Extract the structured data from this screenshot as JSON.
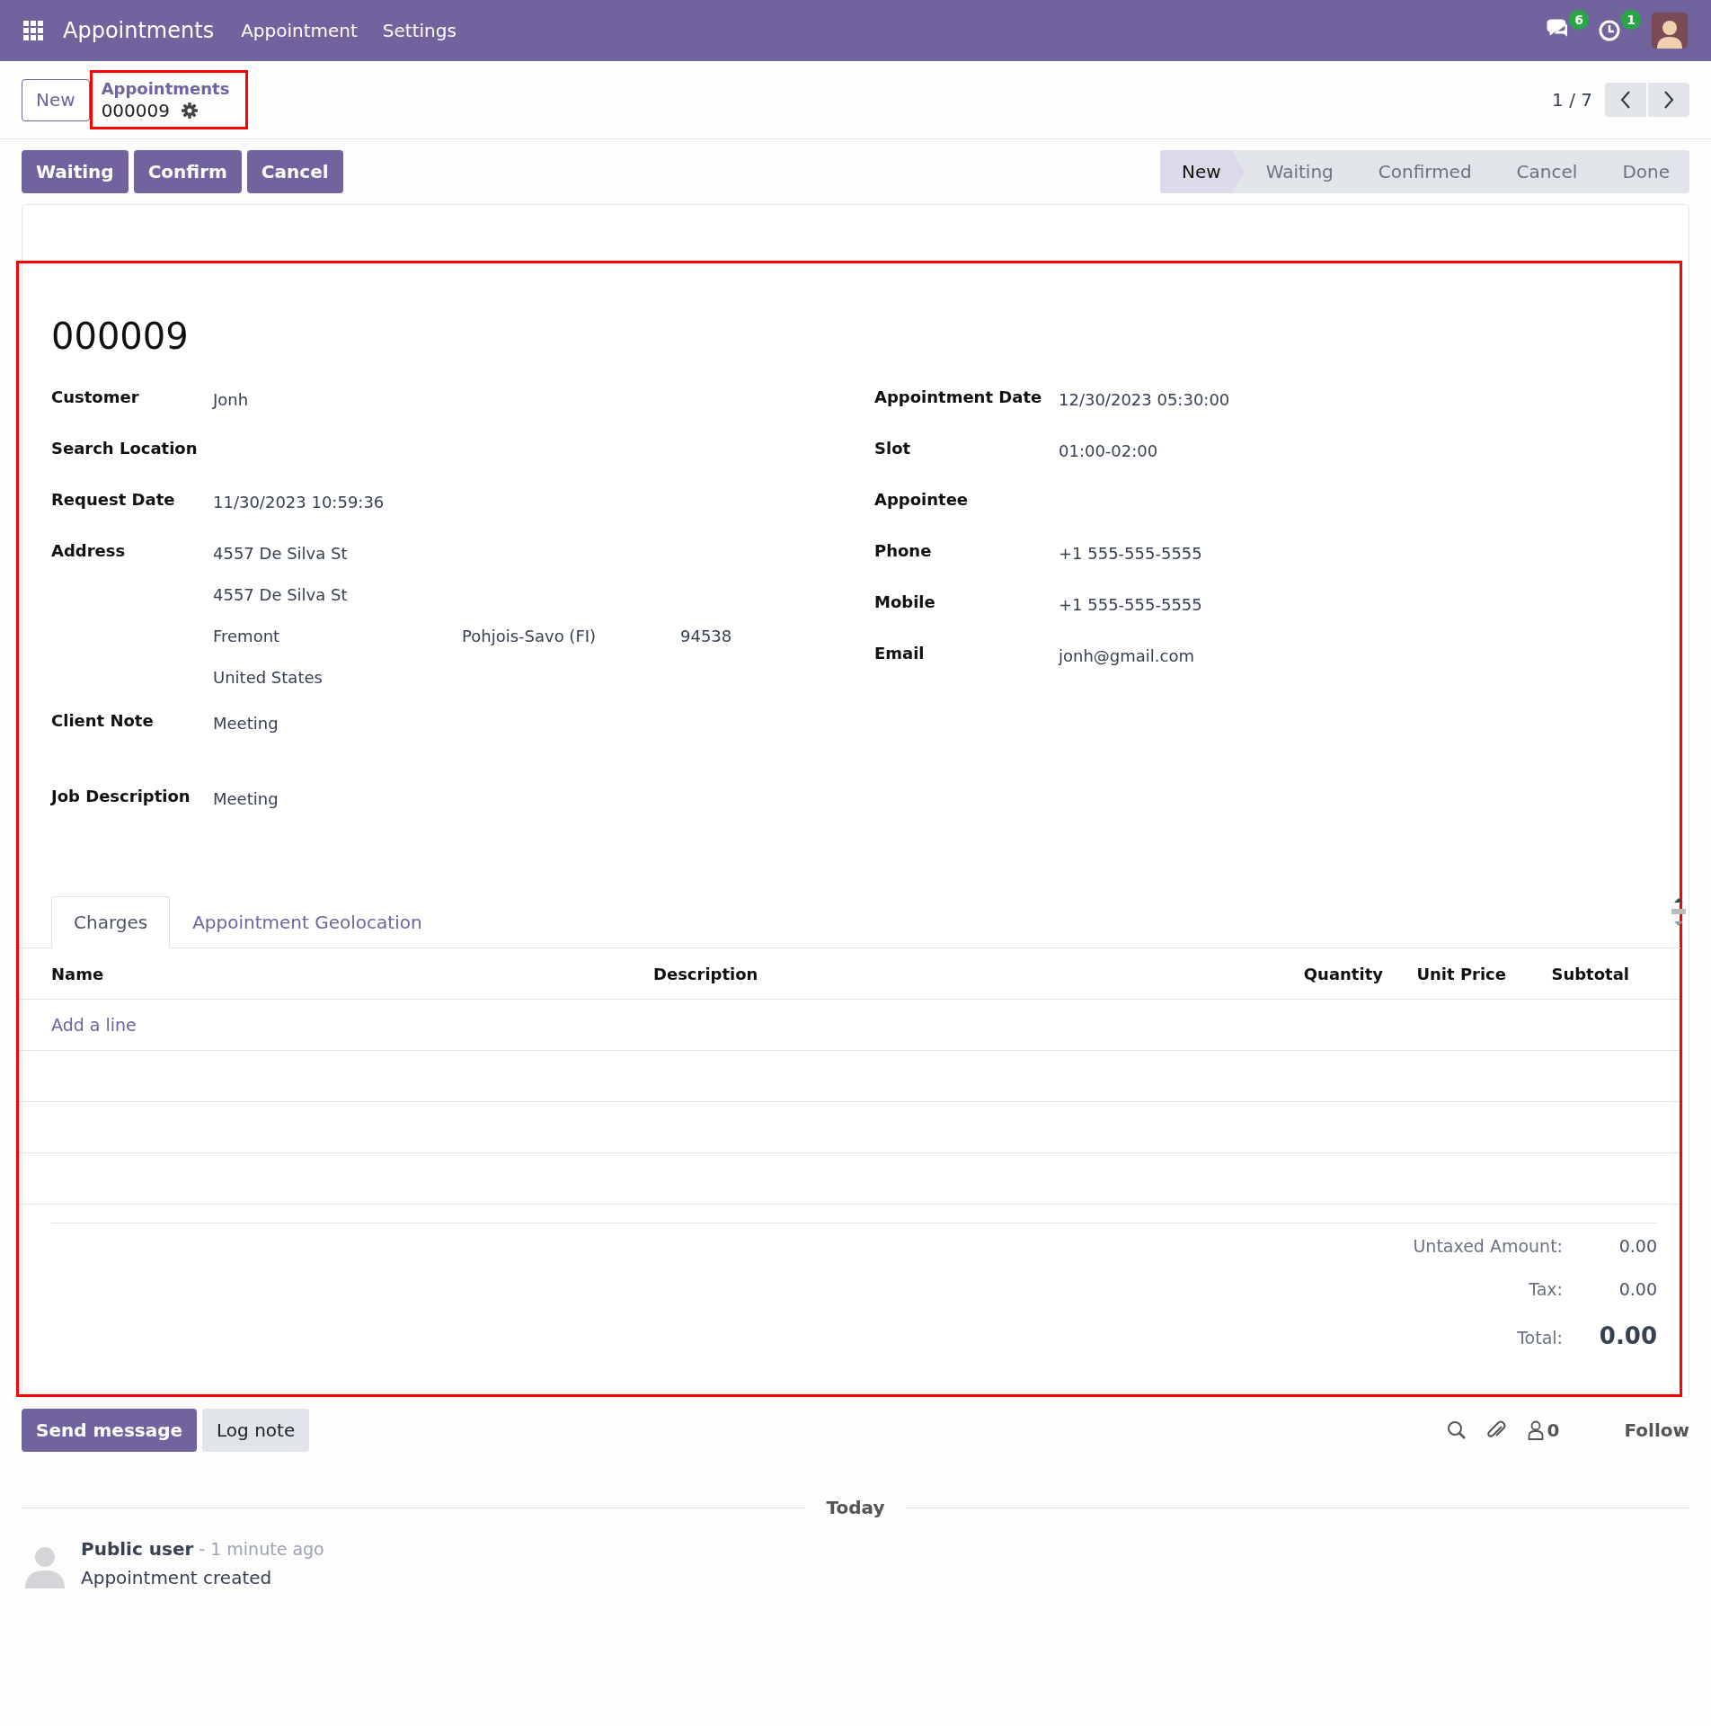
{
  "navbar": {
    "app_name": "Appointments",
    "menu": [
      "Appointment",
      "Settings"
    ],
    "systray": [
      {
        "kind": "messages",
        "badge": "6"
      },
      {
        "kind": "activities",
        "badge": "1"
      },
      {
        "kind": "avatar"
      }
    ]
  },
  "control_panel": {
    "new_button": "New",
    "breadcrumb": {
      "parent": "Appointments",
      "current": "000009",
      "highlighted": true
    },
    "pager": "1 / 7"
  },
  "action_buttons": [
    "Waiting",
    "Confirm",
    "Cancel"
  ],
  "statusbar": [
    {
      "label": "New",
      "selected": true
    },
    {
      "label": "Waiting",
      "selected": false
    },
    {
      "label": "Confirmed",
      "selected": false
    },
    {
      "label": "Cancel",
      "selected": false
    },
    {
      "label": "Done",
      "selected": false
    }
  ],
  "form": {
    "highlighted": true,
    "title": "000009",
    "left_fields": [
      {
        "kind": "text",
        "label": "Customer",
        "value": "Jonh"
      },
      {
        "kind": "text",
        "label": "Search Location"
      },
      {
        "kind": "text",
        "label": "Request Date",
        "value": "11/30/2023 10:59:36"
      },
      {
        "kind": "address",
        "label": "Address",
        "street": "4557 De Silva St",
        "street2": "4557 De Silva St",
        "city": "Fremont",
        "state": "Pohjois-Savo (FI)",
        "zip": "94538",
        "country": "United States"
      },
      {
        "kind": "note",
        "label": "Client Note",
        "value": "Meeting"
      },
      {
        "kind": "note",
        "label": "Job Description",
        "value": "Meeting"
      }
    ],
    "right_fields": [
      {
        "kind": "text",
        "label": "Appointment Date",
        "value": "12/30/2023 05:30:00"
      },
      {
        "kind": "text",
        "label": "Slot",
        "value": "01:00-02:00"
      },
      {
        "kind": "text",
        "label": "Appointee"
      },
      {
        "kind": "text",
        "label": "Phone",
        "value": "+1 555-555-5555"
      },
      {
        "kind": "text",
        "label": "Mobile",
        "value": "+1 555-555-5555"
      },
      {
        "kind": "text",
        "label": "Email",
        "value": "jonh@gmail.com"
      }
    ],
    "tabs": [
      {
        "label": "Charges",
        "selected": true
      },
      {
        "label": "Appointment Geolocation",
        "selected": false
      }
    ],
    "table": {
      "columns": [
        {
          "label": "Name",
          "kind": "text"
        },
        {
          "label": "Description",
          "kind": "text"
        },
        {
          "label": "Quantity",
          "kind": "number"
        },
        {
          "label": "Unit Price",
          "kind": "number"
        },
        {
          "label": "Subtotal",
          "kind": "number"
        }
      ],
      "add_line": "Add a line"
    },
    "totals": [
      {
        "kind": "normal",
        "label": "Untaxed Amount:",
        "value": "0.00"
      },
      {
        "kind": "normal",
        "label": "Tax:",
        "value": "0.00"
      },
      {
        "kind": "grand",
        "label": "Total:",
        "value": "0.00"
      }
    ]
  },
  "chatter": {
    "buttons": [
      {
        "kind": "primary",
        "label": "Send message"
      },
      {
        "kind": "secondary",
        "label": "Log note"
      }
    ],
    "followers": "0",
    "follow": "Follow",
    "divider": "Today",
    "messages": [
      {
        "author": "Public user",
        "time": "- 1 minute ago",
        "body": "Appointment created"
      }
    ]
  }
}
